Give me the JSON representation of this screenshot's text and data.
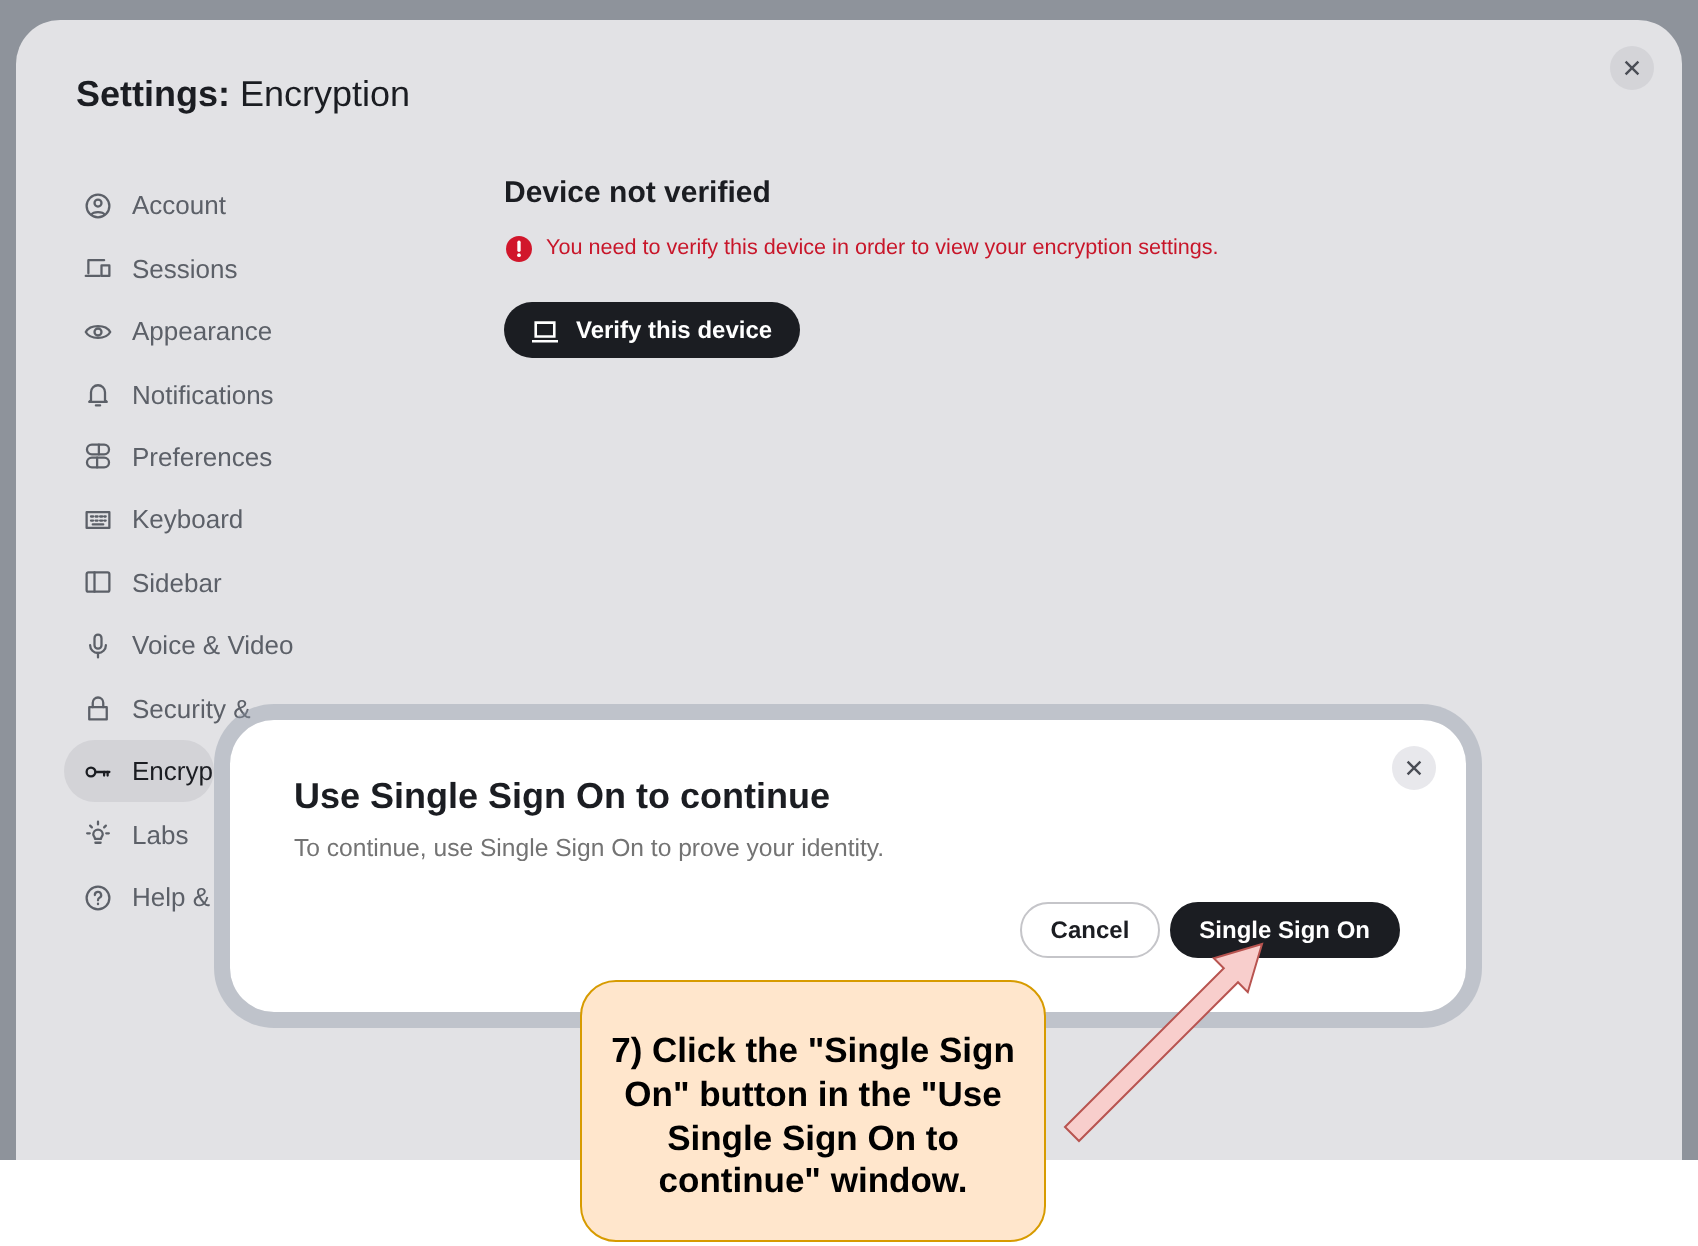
{
  "window": {
    "title": "**Settings:** Encryption"
  },
  "sidebar": {
    "items": [
      {
        "label": "Account",
        "selected": false
      },
      {
        "label": "Sessions",
        "selected": false
      },
      {
        "label": "Appearance",
        "selected": false
      },
      {
        "label": "Notifications",
        "selected": false
      },
      {
        "label": "Preferences",
        "selected": false
      },
      {
        "label": "Keyboard",
        "selected": false
      },
      {
        "label": "Sidebar",
        "selected": false
      },
      {
        "label": "Voice & Video",
        "selected": false
      },
      {
        "label": "Security &",
        "selected": false
      },
      {
        "label": "Encryp",
        "selected": true
      },
      {
        "label": "Labs",
        "selected": false
      },
      {
        "label": "Help &",
        "selected": false
      }
    ]
  },
  "content": {
    "heading": "Device not verified",
    "error": "You need to verify this device in order to view your encryption settings.",
    "verify_button": "Verify this device"
  },
  "dialog": {
    "title": "Use Single Sign On to continue",
    "description": "To continue, use Single Sign On to prove your identity.",
    "buttons": [
      {
        "label": "Cancel",
        "kind": "secondary"
      },
      {
        "label": "Single Sign On",
        "kind": "primary"
      }
    ]
  },
  "callout": {
    "text": "7) Click the \"Single Sign On\" button in the \"Use Single Sign On to continue\" window."
  }
}
